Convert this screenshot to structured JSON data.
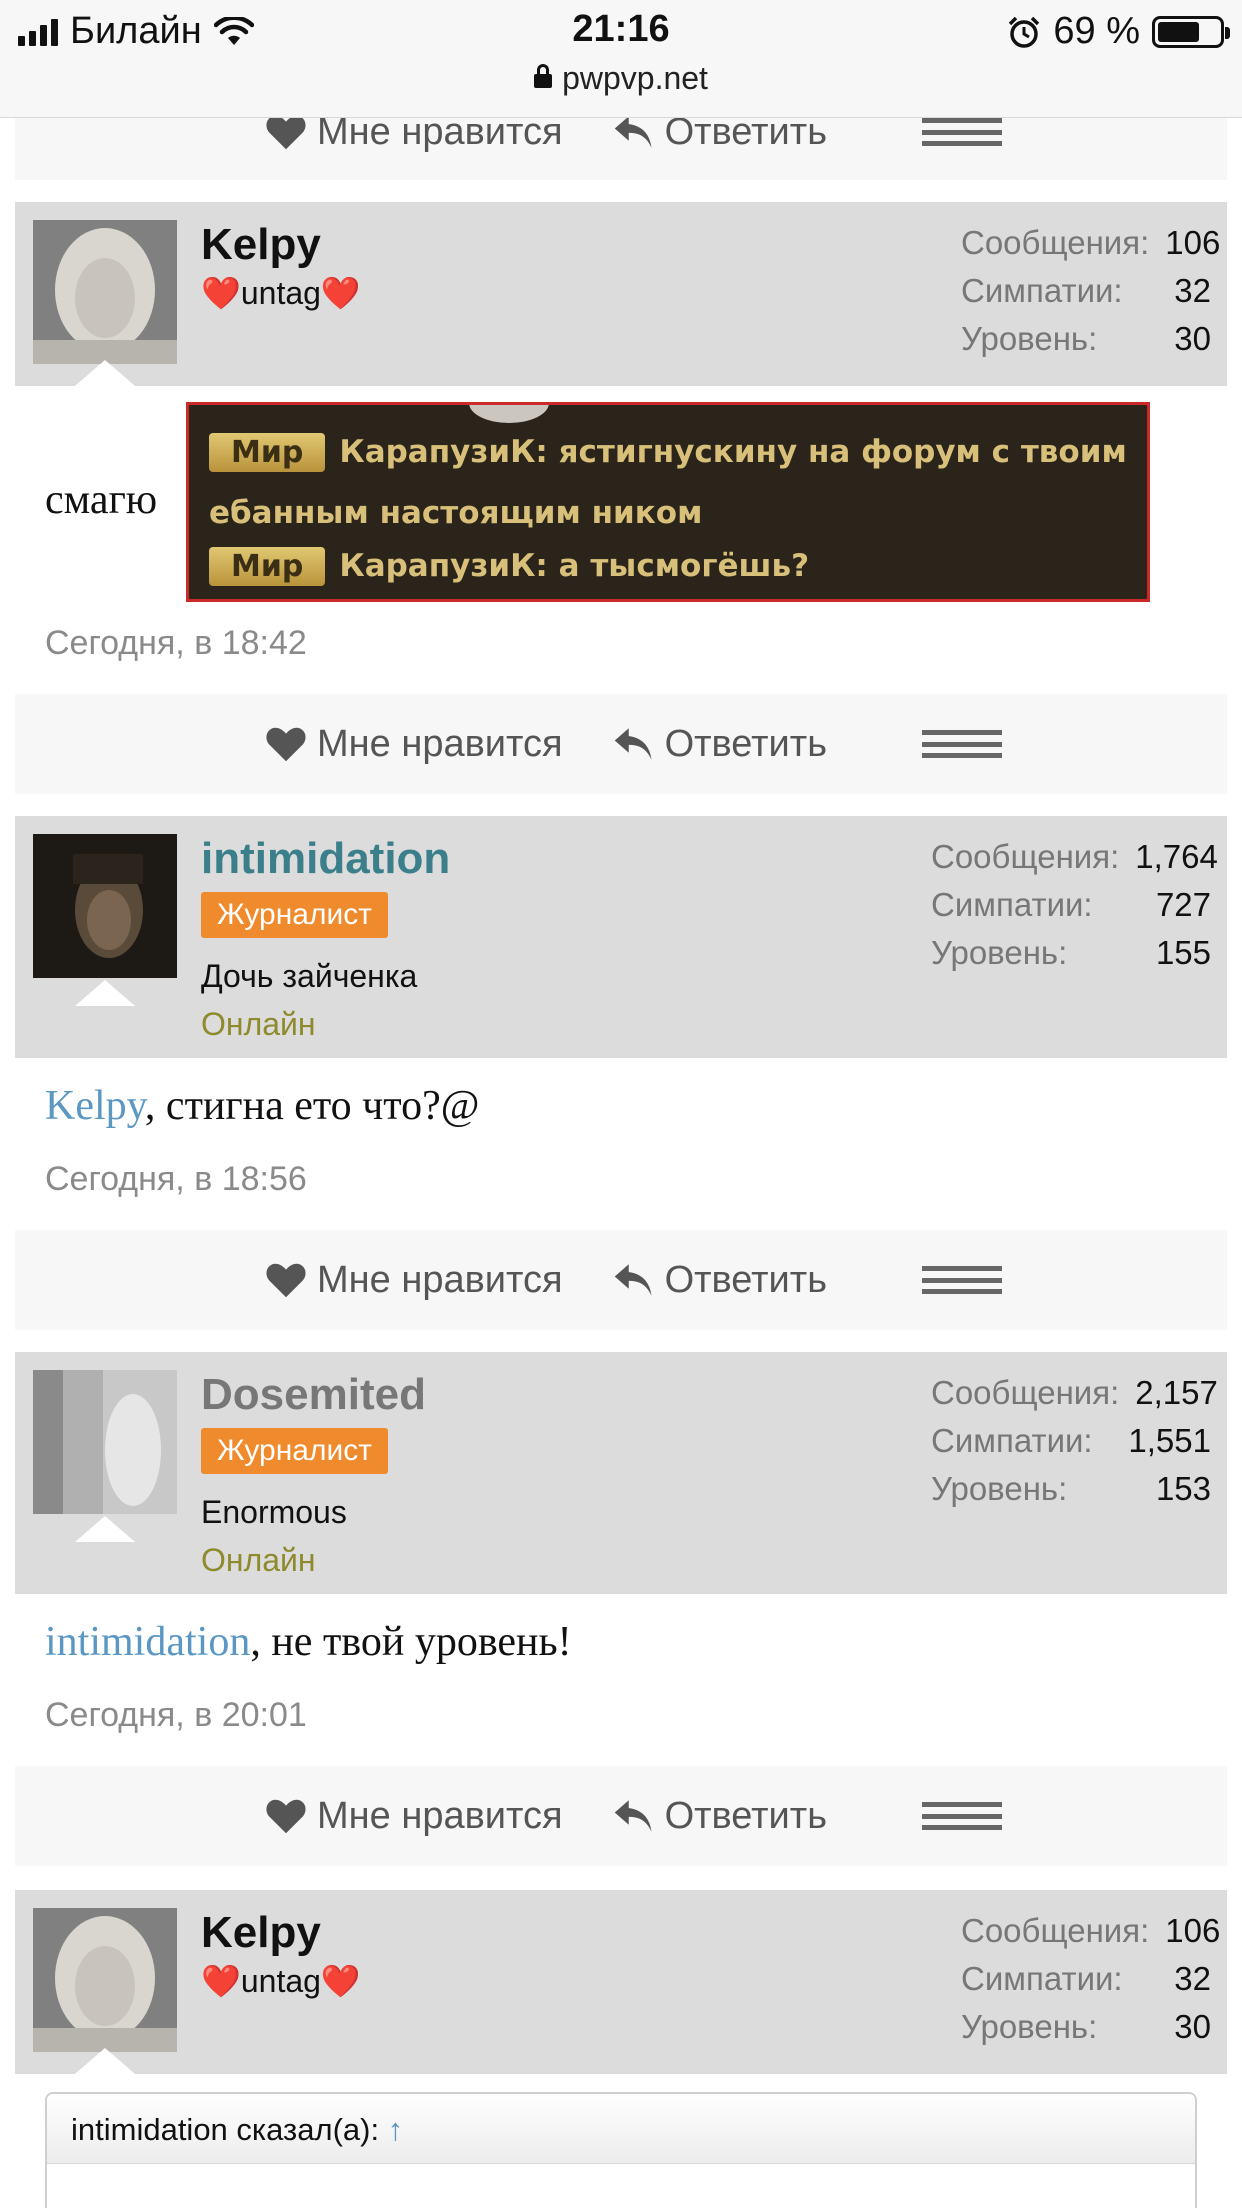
{
  "status_bar": {
    "carrier": "Билайн",
    "time": "21:16",
    "battery": "69 %",
    "battery_level": 0.69,
    "url": "pwpvp.net"
  },
  "actions": {
    "like": "Мне нравится",
    "reply": "Ответить"
  },
  "posts": [
    {
      "author": "Kelpy",
      "title": "❤️untag❤️",
      "stats": [
        {
          "label": "Сообщения:",
          "value": "106"
        },
        {
          "label": "Симпатии:",
          "value": "32"
        },
        {
          "label": "Уровень:",
          "value": "30"
        }
      ],
      "text": "смагю",
      "image_lines": [
        {
          "chip": "Мир",
          "text": "КарапузиК: ястигнускину на форум с твоим"
        },
        {
          "chip": "",
          "text": "ебанным настоящим ником"
        },
        {
          "chip": "Мир",
          "text": "КарапузиК: а тысмогёшь?"
        }
      ],
      "date": "Сегодня, в 18:42"
    },
    {
      "author": "intimidation",
      "badge": "Журналист",
      "title": "Дочь зайченка",
      "status": "Онлайн",
      "stats": [
        {
          "label": "Сообщения:",
          "value": "1,764"
        },
        {
          "label": "Симпатии:",
          "value": "727"
        },
        {
          "label": "Уровень:",
          "value": "155"
        }
      ],
      "mention": "Kelpy",
      "text": ", стигна ето что?@",
      "date": "Сегодня, в 18:56"
    },
    {
      "author": "Dosemited",
      "badge": "Журналист",
      "title": "Enormous",
      "status": "Онлайн",
      "stats": [
        {
          "label": "Сообщения:",
          "value": "2,157"
        },
        {
          "label": "Симпатии:",
          "value": "1,551"
        },
        {
          "label": "Уровень:",
          "value": "153"
        }
      ],
      "mention": "intimidation",
      "text": ", не твой уровень!",
      "date": "Сегодня, в 20:01"
    },
    {
      "author": "Kelpy",
      "title": "❤️untag❤️",
      "stats": [
        {
          "label": "Сообщения:",
          "value": "106"
        },
        {
          "label": "Симпатии:",
          "value": "32"
        },
        {
          "label": "Уровень:",
          "value": "30"
        }
      ],
      "quote_header": "intimidation сказал(а):",
      "quote_arrow": "↑"
    }
  ]
}
